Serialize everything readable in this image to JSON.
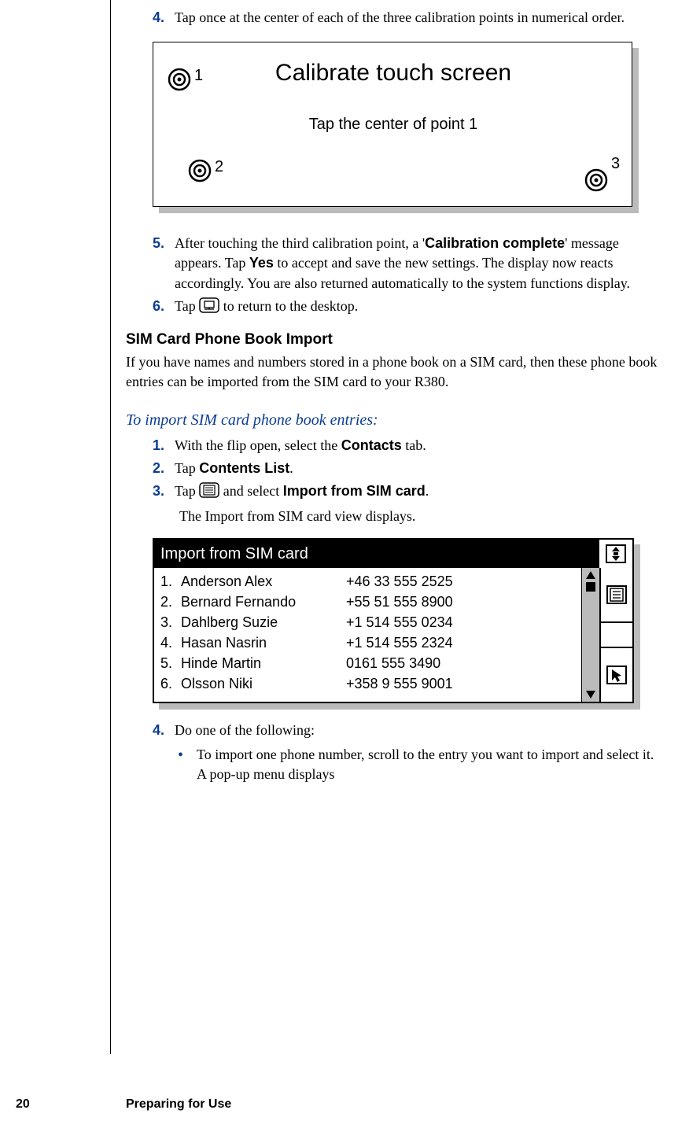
{
  "step4": {
    "num": "4.",
    "text": "Tap once at the center of each of the three calibration points in numerical order."
  },
  "calib": {
    "title": "Calibrate touch screen",
    "subtitle": "Tap the center of point 1",
    "p1": "1",
    "p2": "2",
    "p3": "3"
  },
  "step5": {
    "num": "5.",
    "text_a": "After touching the third calibration point, a '",
    "bold_a": "Calibration complete",
    "text_b": "' message appears. Tap ",
    "bold_b": "Yes",
    "text_c": " to accept and save the new settings. The display now reacts accordingly. You are also returned automatically to the system functions display."
  },
  "step6": {
    "num": "6.",
    "text_a": "Tap ",
    "text_b": " to return to the desktop."
  },
  "sim_section": {
    "heading": "SIM Card Phone Book Import",
    "para": "If you have names and numbers stored in a phone book on a SIM card, then these phone book entries can be imported from the SIM card to your R380."
  },
  "import_proc": {
    "heading": "To import SIM card phone book entries:",
    "s1": {
      "num": "1.",
      "a": "With the flip open, select the ",
      "b": "Contacts",
      "c": " tab."
    },
    "s2": {
      "num": "2.",
      "a": "Tap ",
      "b": "Contents List",
      "c": "."
    },
    "s3": {
      "num": "3.",
      "a": "Tap ",
      "b": " and select ",
      "c": "Import from SIM card",
      "d": "."
    },
    "s3_sub": "The Import from SIM card view displays."
  },
  "sim_screen": {
    "title": "Import from SIM card",
    "rows": [
      {
        "idx": "1.",
        "name": "Anderson Alex",
        "num": "+46 33 555 2525"
      },
      {
        "idx": "2.",
        "name": "Bernard Fernando",
        "num": "+55 51 555 8900"
      },
      {
        "idx": "3.",
        "name": "Dahlberg Suzie",
        "num": "+1 514 555 0234"
      },
      {
        "idx": "4.",
        "name": "Hasan Nasrin",
        "num": "+1 514 555 2324"
      },
      {
        "idx": "5.",
        "name": "Hinde Martin",
        "num": "0161 555 3490"
      },
      {
        "idx": "6.",
        "name": "Olsson Niki",
        "num": "+358 9 555 9001"
      }
    ]
  },
  "step4b": {
    "num": "4.",
    "text": "Do one of the following:"
  },
  "bullet1": "To import one phone number, scroll to the entry you want to import and select it. A pop-up menu displays",
  "footer": {
    "page": "20",
    "title": "Preparing for Use"
  }
}
